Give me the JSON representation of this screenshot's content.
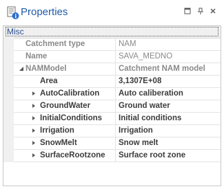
{
  "panel": {
    "title": "Properties",
    "colors": {
      "title": "#1e5aa8",
      "category": "#2a4d8f",
      "readonly": "#8a8a8a",
      "text": "#3c3c3c"
    }
  },
  "grid": {
    "category": "Misc",
    "rows": [
      {
        "name": "Catchment type",
        "value": "NAM",
        "state": "readonly"
      },
      {
        "name": "Name",
        "value": "SAVA_MEDNO",
        "state": "readonly"
      },
      {
        "name": "NAMModel",
        "value": "Catchment NAM model",
        "state": "readonly",
        "expander": "expanded"
      },
      {
        "name": "Area",
        "value": "3,1307E+08",
        "state": "editable"
      },
      {
        "name": "AutoCalibration",
        "value": "Auto caliberation",
        "state": "editable",
        "expander": "collapsed"
      },
      {
        "name": "GroundWater",
        "value": "Ground water",
        "state": "editable",
        "expander": "collapsed"
      },
      {
        "name": "InitialConditions",
        "value": "Initial conditions",
        "state": "editable",
        "expander": "collapsed"
      },
      {
        "name": "Irrigation",
        "value": "Irrigation",
        "state": "editable",
        "expander": "collapsed"
      },
      {
        "name": "SnowMelt",
        "value": "Snow melt",
        "state": "editable",
        "expander": "collapsed"
      },
      {
        "name": "SurfaceRootzone",
        "value": "Surface root zone",
        "state": "editable",
        "expander": "collapsed"
      }
    ]
  }
}
